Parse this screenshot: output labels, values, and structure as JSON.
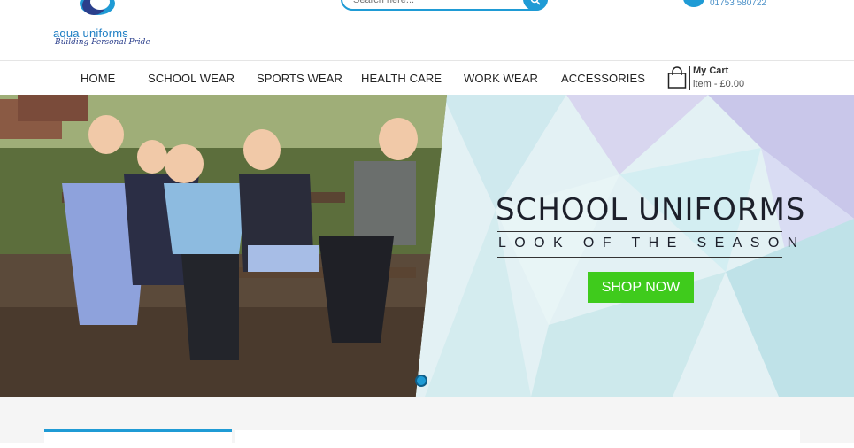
{
  "header": {
    "logo_name": "aqua uniforms",
    "logo_tagline": "Building Personal Pride",
    "search_placeholder": "Search here...",
    "phone": "01753 580722"
  },
  "nav": {
    "items": [
      "HOME",
      "SCHOOL WEAR",
      "SPORTS WEAR",
      "HEALTH CARE",
      "WORK WEAR",
      "ACCESSORIES"
    ],
    "cart_title": "My Cart",
    "cart_summary": "item - £0.00"
  },
  "hero": {
    "title": "SCHOOL UNIFORMS",
    "subtitle": "LOOK OF THE SEASON",
    "cta": "SHOP NOW"
  },
  "colors": {
    "accent": "#1f9bd5",
    "cta": "#3fcb1c",
    "logo_navy": "#2b3f8c"
  },
  "icons": {
    "search": "search-icon",
    "phone": "phone-icon",
    "cart": "shopping-bag-icon"
  }
}
